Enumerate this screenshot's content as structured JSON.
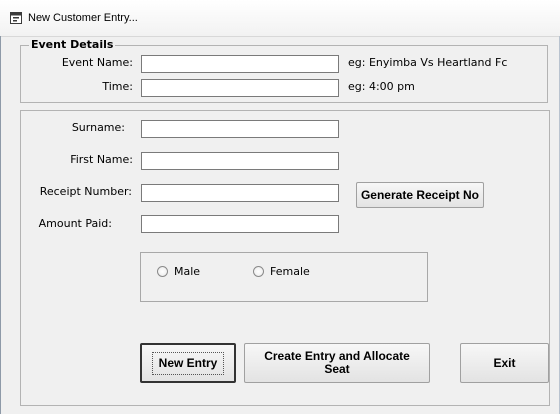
{
  "window": {
    "title": "New Customer Entry..."
  },
  "event_group": {
    "title": "Event Details",
    "event_name_label": "Event Name:",
    "event_name_value": "",
    "event_name_hint": "eg: Enyimba Vs Heartland Fc",
    "time_label": "Time:",
    "time_value": "",
    "time_hint": "eg: 4:00 pm"
  },
  "customer": {
    "surname_label": "Surname:",
    "surname_value": "",
    "firstname_label": "First Name:",
    "firstname_value": "",
    "receipt_label": "Receipt Number:",
    "receipt_value": "",
    "amount_label": "Amount Paid:",
    "amount_value": "",
    "generate_button": "Generate Receipt No"
  },
  "gender": {
    "male_label": "Male",
    "female_label": "Female",
    "selected": ""
  },
  "actions": {
    "new_entry": "New Entry",
    "create_allocate": "Create Entry and Allocate Seat",
    "exit": "Exit"
  }
}
